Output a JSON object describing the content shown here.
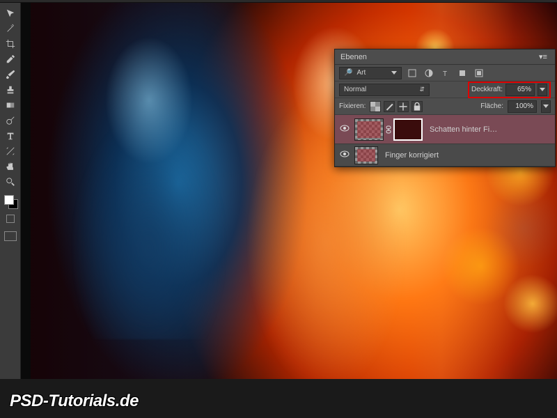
{
  "panel": {
    "title": "Ebenen",
    "search_label": "Art",
    "filter_icons": [
      "image-filter",
      "adjustment-filter",
      "type-filter",
      "shape-filter",
      "smart-filter"
    ],
    "blend_mode": "Normal",
    "opacity_label": "Deckkraft:",
    "opacity_value": "65%",
    "lock_label": "Fixieren:",
    "fill_label": "Fläche:",
    "fill_value": "100%",
    "layer1_name": "Schatten hinter Fi…",
    "layer2_name": "Finger korrigiert"
  },
  "watermark": "PSD-Tutorials.de",
  "tools": [
    "move",
    "marquee",
    "lasso",
    "wand",
    "crop",
    "eyedropper",
    "heal",
    "brush",
    "stamp",
    "eraser",
    "gradient",
    "dodge",
    "type",
    "pen",
    "path",
    "hand",
    "zoom"
  ]
}
